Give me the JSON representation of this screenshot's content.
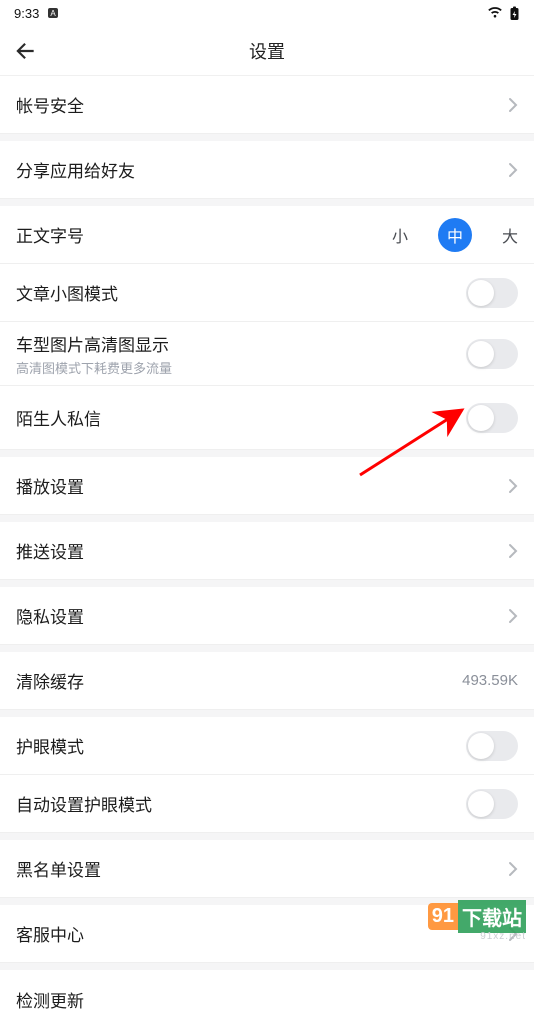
{
  "status": {
    "time": "9:33"
  },
  "nav": {
    "title": "设置"
  },
  "cells": {
    "account_security": {
      "title": "帐号安全"
    },
    "share_app": {
      "title": "分享应用给好友"
    },
    "font_size": {
      "title": "正文字号",
      "small": "小",
      "medium": "中",
      "large": "大"
    },
    "thumbnail_mode": {
      "title": "文章小图模式"
    },
    "hd_image": {
      "title": "车型图片高清图显示",
      "sub": "高清图模式下耗费更多流量"
    },
    "stranger_msg": {
      "title": "陌生人私信"
    },
    "playback": {
      "title": "播放设置"
    },
    "push": {
      "title": "推送设置"
    },
    "privacy": {
      "title": "隐私设置"
    },
    "clear_cache": {
      "title": "清除缓存",
      "value": "493.59K"
    },
    "eye_mode": {
      "title": "护眼模式"
    },
    "auto_eye_mode": {
      "title": "自动设置护眼模式"
    },
    "blacklist": {
      "title": "黑名单设置"
    },
    "support": {
      "title": "客服中心"
    },
    "check_update": {
      "title": "检测更新"
    }
  },
  "watermark": {
    "a": "91",
    "b": "下载站",
    "url": "91xz.net"
  }
}
